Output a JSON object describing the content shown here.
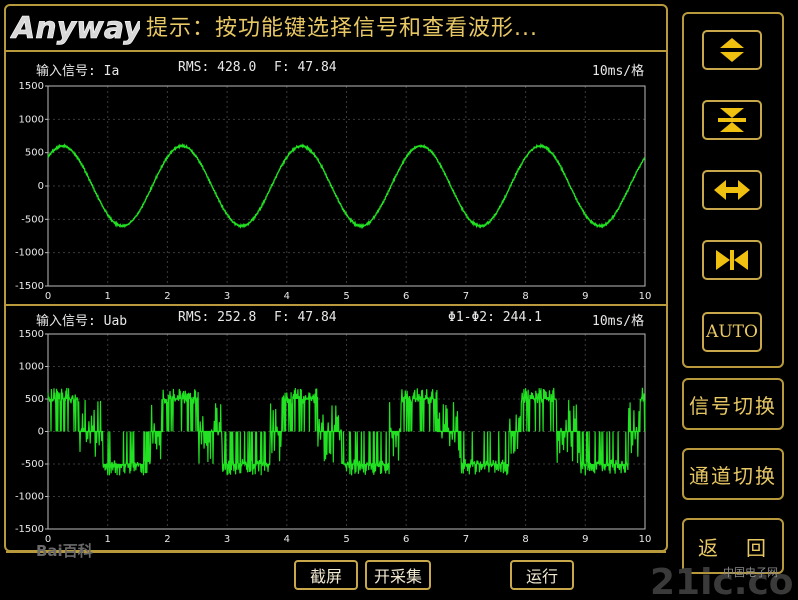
{
  "header": {
    "logo_text": "Anyway",
    "hint": "提示：按功能键选择信号和查看波形..."
  },
  "panel1": {
    "label": "输入信号: Ia",
    "rms": "RMS: 428.0",
    "freq": "F: 47.84",
    "unit": "10ms/格"
  },
  "panel2": {
    "label": "输入信号: Uab",
    "rms": "RMS: 252.8",
    "freq": "F: 47.84",
    "phase": "Φ1-Φ2: 244.1",
    "unit": "10ms/格"
  },
  "side": {
    "auto": "AUTO",
    "signal_switch": "信号切换",
    "channel_switch": "通道切换",
    "back_1": "返",
    "back_2": "回"
  },
  "bottom": {
    "screenshot": "截屏",
    "start_capture": "开采集",
    "run": "运行"
  },
  "watermarks": {
    "baidu": "Bai百科",
    "site": "中国电子网",
    "site_logo": "21ic.com"
  },
  "colors": {
    "accent": "#e8c864",
    "border": "#b89a3c",
    "trace": "#22e022",
    "grid": "#3a3a3a"
  },
  "chart_data": [
    {
      "type": "line",
      "series": [
        {
          "name": "Ia",
          "shape": "sine",
          "amplitude": 600,
          "period": 2.0,
          "phase_at_zero": 430
        }
      ],
      "x": [
        0,
        1,
        2,
        3,
        4,
        5,
        6,
        7,
        8,
        9,
        10
      ],
      "xlim": [
        0,
        10
      ],
      "ylim": [
        -1500,
        1500
      ],
      "yticks": [
        1500,
        1000,
        500,
        0,
        -500,
        -1000,
        -1500
      ],
      "xticks": [
        0,
        1,
        2,
        3,
        4,
        5,
        6,
        7,
        8,
        9,
        10
      ],
      "grid": true
    },
    {
      "type": "line",
      "series": [
        {
          "name": "Uab",
          "shape": "pwm-stepped",
          "levels": [
            0,
            500,
            0,
            -500
          ],
          "period": 2.0
        }
      ],
      "x": [
        0,
        1,
        2,
        3,
        4,
        5,
        6,
        7,
        8,
        9,
        10
      ],
      "xlim": [
        0,
        10
      ],
      "ylim": [
        -1500,
        1500
      ],
      "yticks": [
        1500,
        1000,
        500,
        0,
        -500,
        -1000,
        -1500
      ],
      "xticks": [
        0,
        1,
        2,
        3,
        4,
        5,
        6,
        7,
        8,
        9,
        10
      ],
      "grid": true
    }
  ]
}
